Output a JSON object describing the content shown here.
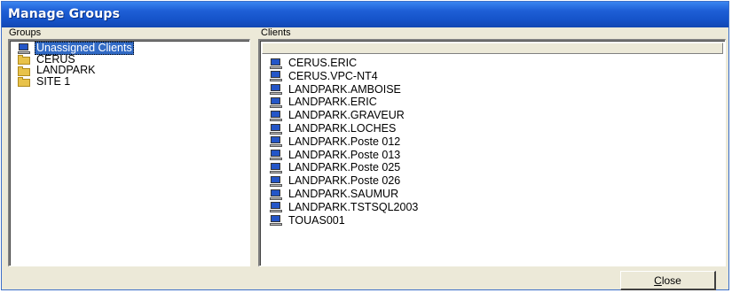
{
  "window": {
    "title": "Manage Groups"
  },
  "groups": {
    "header": "Groups",
    "items": [
      {
        "label": "Unassigned Clients",
        "icon": "computer-icon",
        "selected": true
      },
      {
        "label": "CERUS",
        "icon": "folder-icon",
        "selected": false
      },
      {
        "label": "LANDPARK",
        "icon": "folder-icon",
        "selected": false
      },
      {
        "label": "SITE 1",
        "icon": "folder-icon",
        "selected": false
      }
    ]
  },
  "clients": {
    "header": "Clients",
    "items": [
      {
        "label": "CERUS.ERIC",
        "icon": "computer-icon"
      },
      {
        "label": "CERUS.VPC-NT4",
        "icon": "computer-icon"
      },
      {
        "label": "LANDPARK.AMBOISE",
        "icon": "computer-icon"
      },
      {
        "label": "LANDPARK.ERIC",
        "icon": "computer-icon"
      },
      {
        "label": "LANDPARK.GRAVEUR",
        "icon": "computer-icon"
      },
      {
        "label": "LANDPARK.LOCHES",
        "icon": "computer-icon"
      },
      {
        "label": "LANDPARK.Poste 012",
        "icon": "computer-icon"
      },
      {
        "label": "LANDPARK.Poste 013",
        "icon": "computer-icon"
      },
      {
        "label": "LANDPARK.Poste 025",
        "icon": "computer-icon"
      },
      {
        "label": "LANDPARK.Poste 026",
        "icon": "computer-icon"
      },
      {
        "label": "LANDPARK.SAUMUR",
        "icon": "computer-icon"
      },
      {
        "label": "LANDPARK.TSTSQL2003",
        "icon": "computer-icon"
      },
      {
        "label": "TOUAS001",
        "icon": "computer-icon"
      }
    ]
  },
  "buttons": {
    "close_mnemonic": "C",
    "close_rest": "lose"
  },
  "colors": {
    "titlebar": "#1553c9",
    "selection": "#316ac5",
    "window_face": "#ece9d8"
  }
}
